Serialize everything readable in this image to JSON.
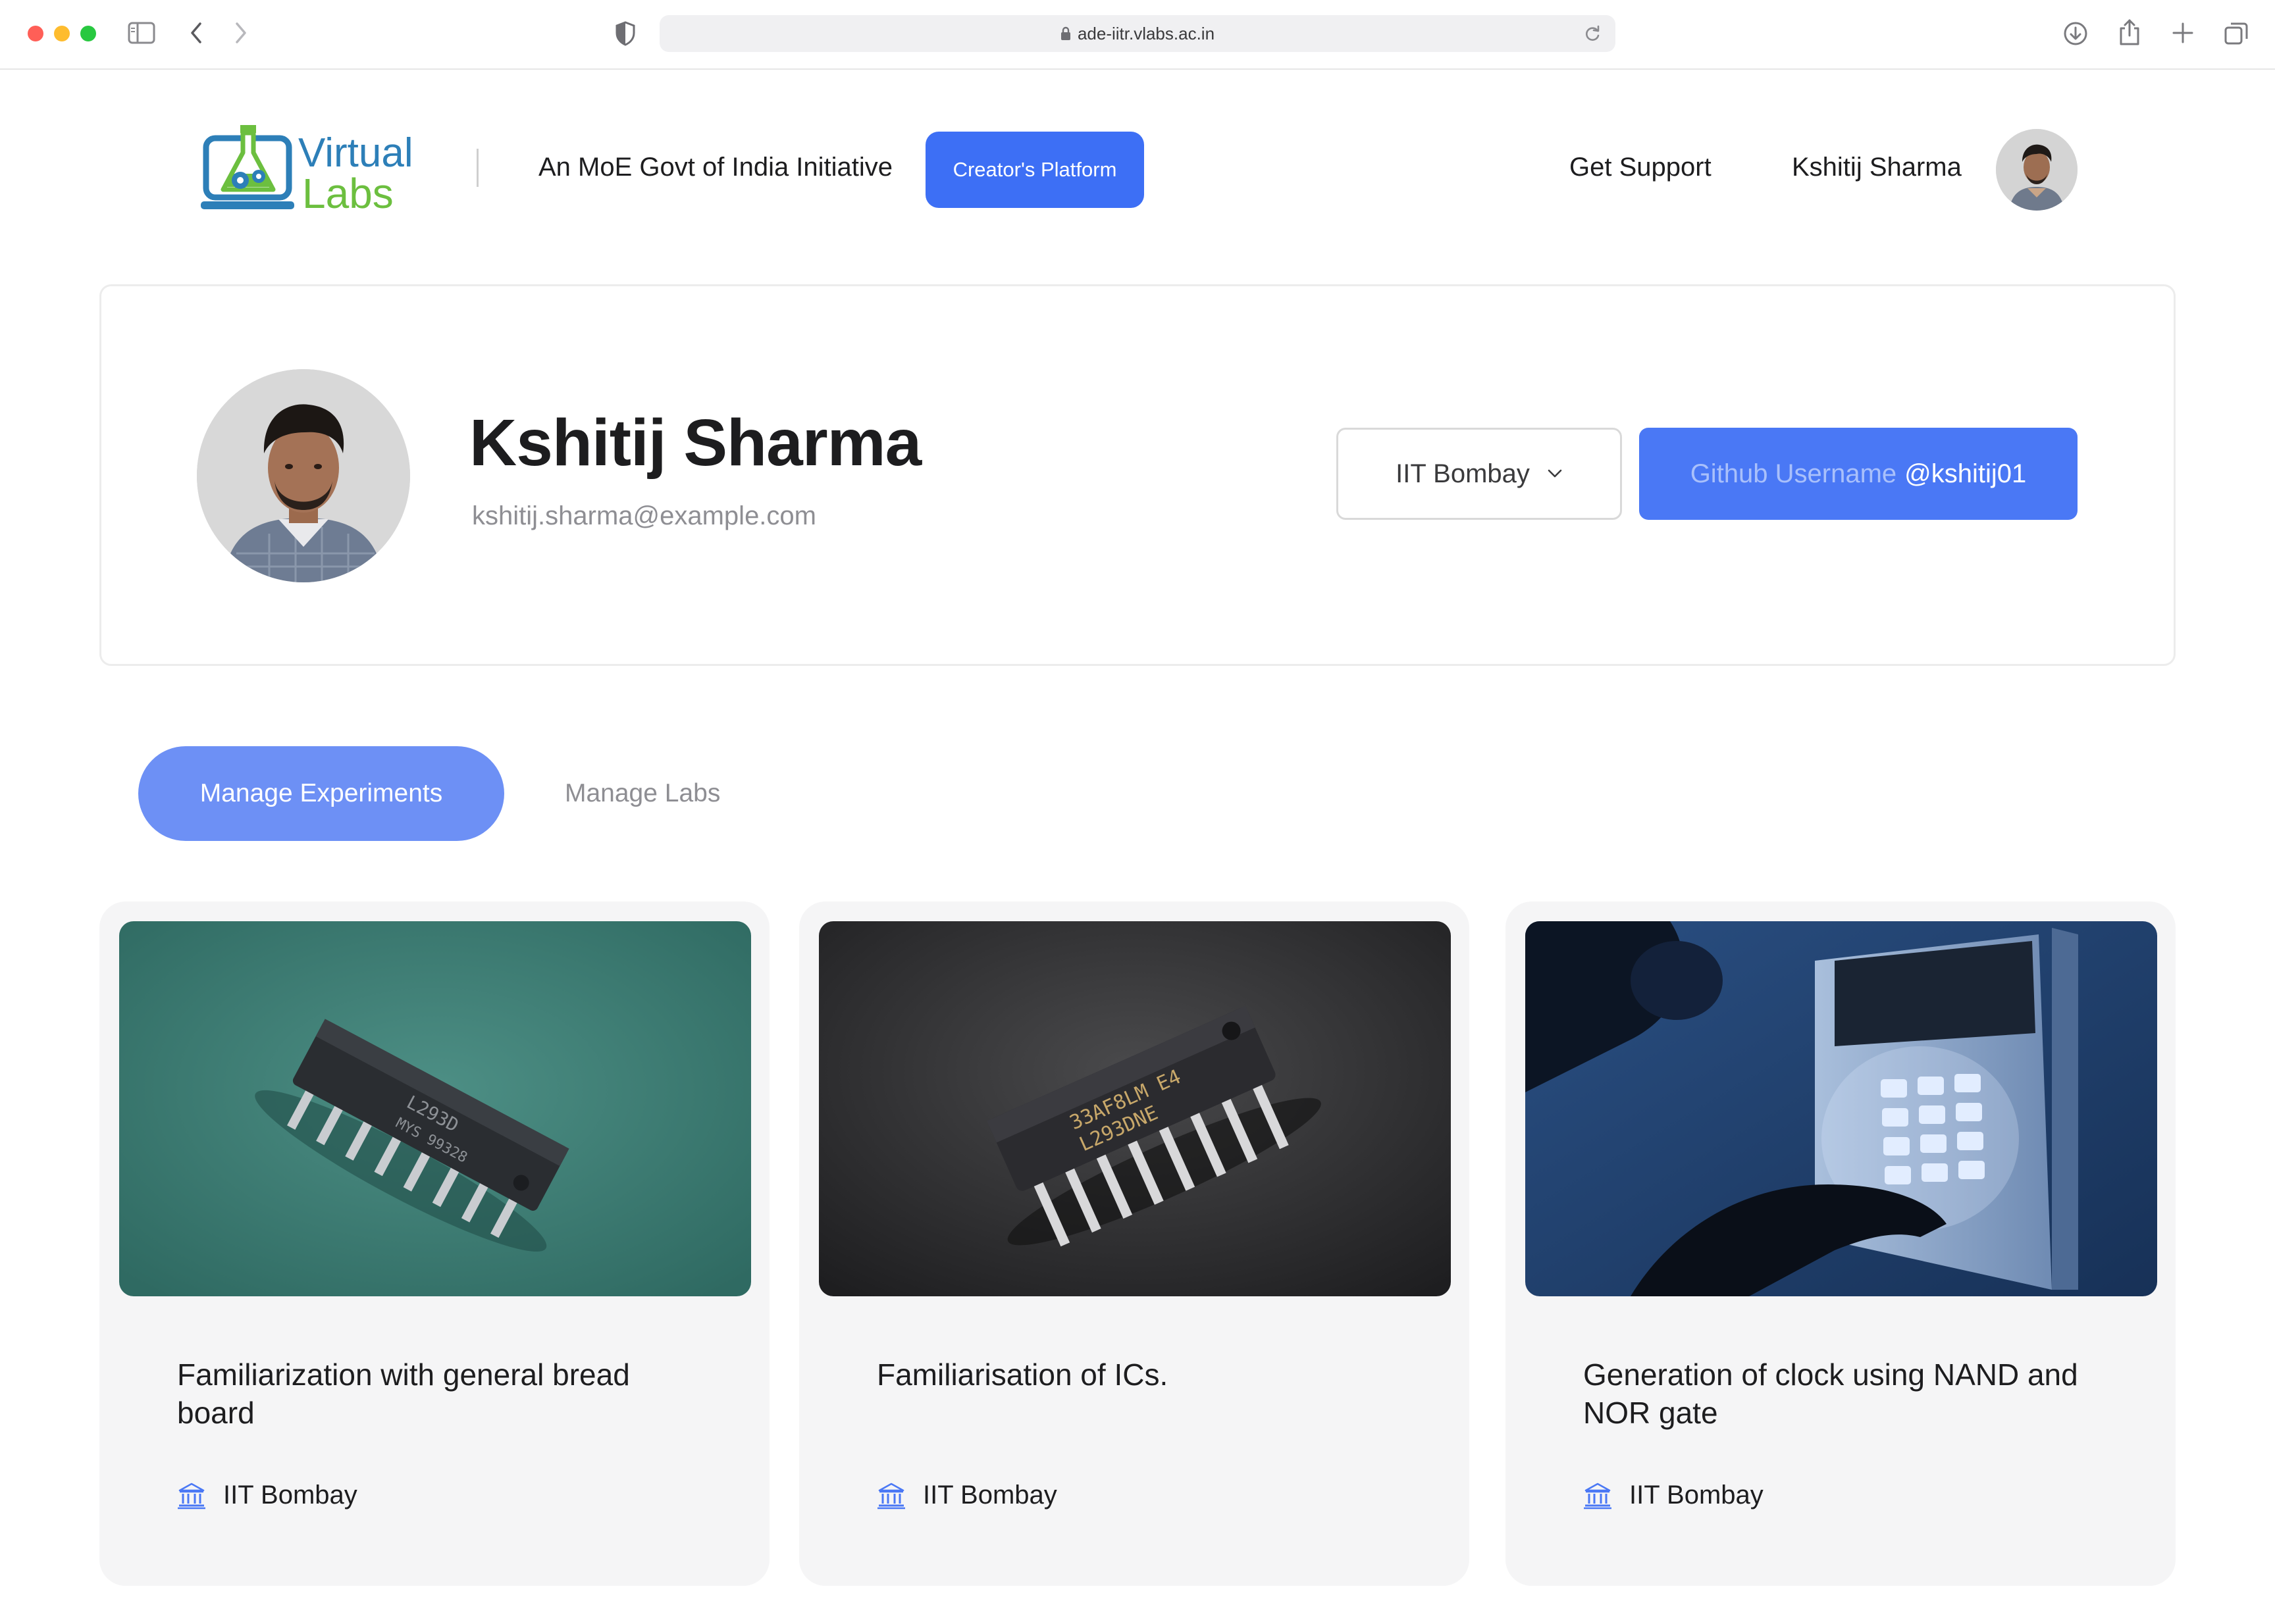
{
  "browser": {
    "url": "ade-iitr.vlabs.ac.in"
  },
  "header": {
    "logo": {
      "line1": "Virtual",
      "line2": "Labs"
    },
    "tagline": "An MoE Govt of India Initiative",
    "creator_button": "Creator's Platform",
    "support_link": "Get Support",
    "user_name": "Kshitij Sharma"
  },
  "profile": {
    "name": "Kshitij Sharma",
    "email": "kshitij.sharma@example.com",
    "institute": "IIT Bombay",
    "github_label": "Github Username",
    "github_username": "@kshitij01"
  },
  "tabs": [
    {
      "label": "Manage Experiments",
      "active": true
    },
    {
      "label": "Manage Labs",
      "active": false
    }
  ],
  "experiments": [
    {
      "title": "Familiarization with general bread board",
      "institute": "IIT Bombay",
      "image": "ic-chip-on-green-icon"
    },
    {
      "title": "Familiarisation of ICs.",
      "institute": "IIT Bombay",
      "image": "ic-chip-on-black-icon"
    },
    {
      "title": "Generation of clock using NAND and NOR gate",
      "institute": "IIT Bombay",
      "image": "keypad-security-panel-icon"
    }
  ],
  "colors": {
    "accent": "#3d6ff5",
    "tab_active": "#6d90f5",
    "logo_blue": "#2d7fb8",
    "logo_green": "#6cbf3f",
    "card_bg": "#f5f5f6"
  }
}
